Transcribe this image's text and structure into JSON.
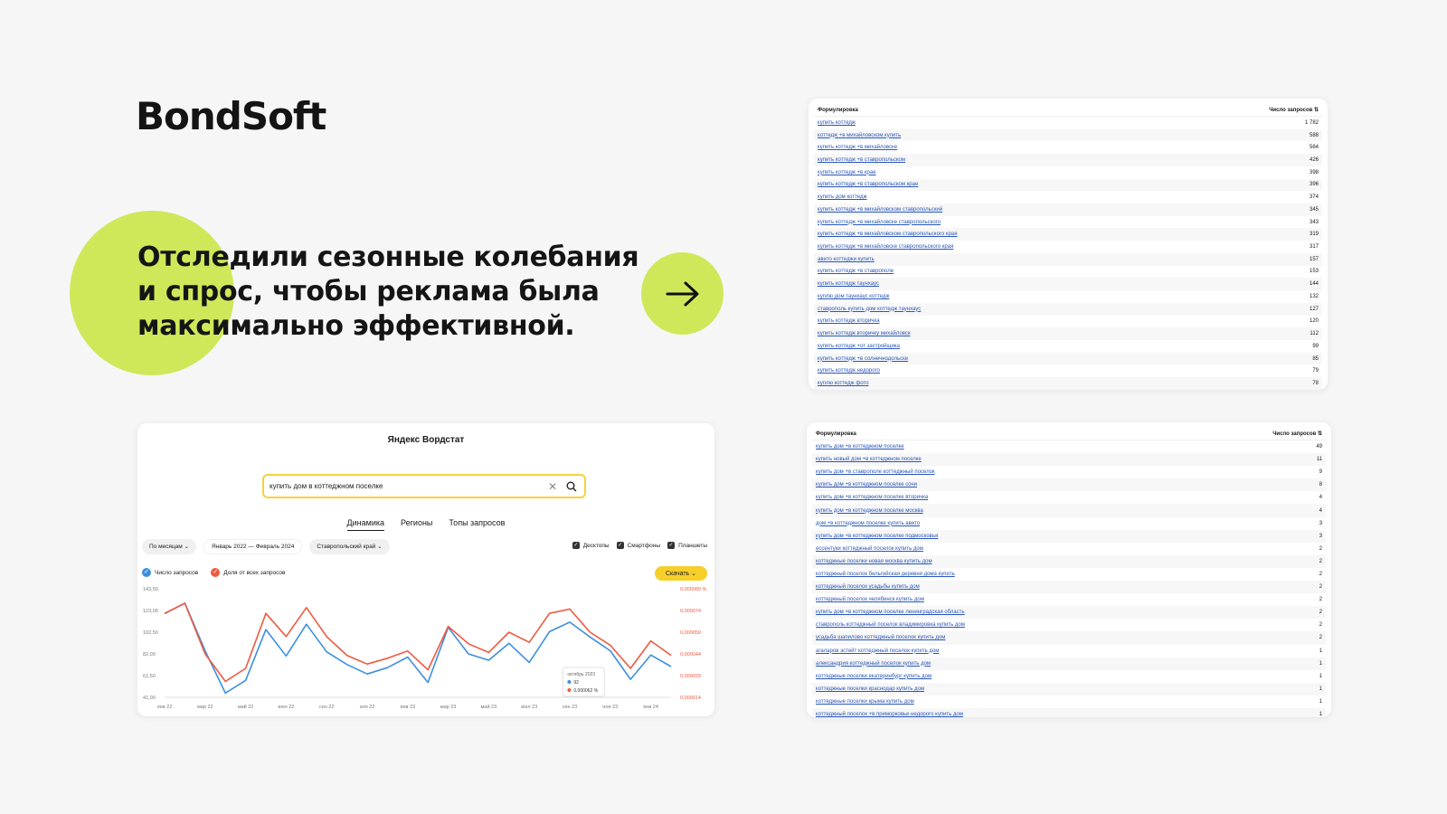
{
  "brand": {
    "logo_text": "BondSoft",
    "accent_color": "#cfe85a"
  },
  "headline": {
    "text": "Отследили сезонные колебания и спрос, чтобы реклама была максимально эффективной."
  },
  "arrow_button": {
    "icon": "arrow-right-icon"
  },
  "wordstat": {
    "title": "Яндекс Вордстат",
    "search_value": "купить дом в коттеджном поселке",
    "tabs": [
      "Динамика",
      "Регионы",
      "Топы запросов"
    ],
    "active_tab": "Динамика",
    "filters": {
      "period_group": "По месяцам",
      "date_range": "Январь 2022 — Февраль 2024",
      "region": "Ставропольский край"
    },
    "devices": [
      "Десктопы",
      "Смартфоны",
      "Планшеты"
    ],
    "legend": {
      "count": "Число запросов",
      "share": "Доля от всех запросов"
    },
    "download_label": "Скачать",
    "tooltip": {
      "title": "октябрь 2023",
      "count": "92",
      "share": "0,000062 %"
    }
  },
  "chart_data": {
    "type": "line",
    "x": [
      "янв 22",
      "фев 22",
      "мар 22",
      "апр 22",
      "май 22",
      "июн 22",
      "июл 22",
      "авг 22",
      "сен 22",
      "окт 22",
      "ноя 22",
      "дек 22",
      "янв 23",
      "фев 23",
      "мар 23",
      "апр 23",
      "май 23",
      "июн 23",
      "июл 23",
      "авг 23",
      "сен 23",
      "окт 23",
      "ноя 23",
      "дек 23",
      "янв 24",
      "фев 24"
    ],
    "x_tick_labels": [
      "янв 22",
      "мар 22",
      "май 22",
      "июл 22",
      "сен 22",
      "ноя 22",
      "янв 23",
      "мар 23",
      "май 23",
      "июл 23",
      "сен 23",
      "ноя 23",
      "янв 24"
    ],
    "y_left_ticks": [
      "143,50",
      "123,00",
      "102,50",
      "82,00",
      "61,50",
      "41,00"
    ],
    "y_right_ticks": [
      "0,000089 %",
      "0,000074",
      "0,000059",
      "0,000044",
      "0,000029",
      "0,000014"
    ],
    "ylim_left": [
      41,
      143.5
    ],
    "ylim_right": [
      1.4e-05,
      8.9e-05
    ],
    "series": [
      {
        "name": "Число запросов",
        "color": "#3d8fe0",
        "axis": "left",
        "values": [
          120,
          130,
          85,
          45,
          57,
          105,
          80,
          110,
          84,
          72,
          63,
          69,
          79,
          55,
          107,
          82,
          76,
          92,
          74,
          103,
          112,
          98,
          85,
          58,
          81,
          70
        ]
      },
      {
        "name": "Доля от всех запросов",
        "color": "#ef5a3e",
        "axis": "right",
        "values": [
          7.2e-05,
          7.9e-05,
          4.4e-05,
          2.5e-05,
          3.4e-05,
          7.2e-05,
          5.6e-05,
          7.6e-05,
          5.6e-05,
          4.3e-05,
          3.7e-05,
          4.1e-05,
          4.6e-05,
          3.3e-05,
          6.3e-05,
          5.1e-05,
          4.5e-05,
          5.9e-05,
          5.2e-05,
          7.2e-05,
          7.5e-05,
          5.9e-05,
          5e-05,
          3.4e-05,
          5.3e-05,
          4.3e-05
        ]
      }
    ]
  },
  "table1": {
    "col_phrase": "Формулировка",
    "col_count": "Число запросов ⇅",
    "rows": [
      {
        "phrase": "купить коттедж",
        "count": "1 782"
      },
      {
        "phrase": "коттедж +в михайловском купить",
        "count": "588"
      },
      {
        "phrase": "купить коттедж +в михайловске",
        "count": "564"
      },
      {
        "phrase": "купить коттедж +в ставропольском",
        "count": "426"
      },
      {
        "phrase": "купить коттедж +в крае",
        "count": "398"
      },
      {
        "phrase": "купить коттедж +в ставропольском крае",
        "count": "396"
      },
      {
        "phrase": "купить дом коттедж",
        "count": "374"
      },
      {
        "phrase": "купить коттедж +в михайловском ставропольский",
        "count": "345"
      },
      {
        "phrase": "купить коттедж +в михайловске ставропольского",
        "count": "343"
      },
      {
        "phrase": "купить коттедж +в михайловском ставропольского края",
        "count": "319"
      },
      {
        "phrase": "купить коттедж +в михайловске ставропольского края",
        "count": "317"
      },
      {
        "phrase": "авито коттеджи купить",
        "count": "157"
      },
      {
        "phrase": "купить коттедж +в ставрополе",
        "count": "153"
      },
      {
        "phrase": "купить коттедж таунхаус",
        "count": "144"
      },
      {
        "phrase": "куплю дом таунхаус коттедж",
        "count": "132"
      },
      {
        "phrase": "ставрополь купить дом коттедж таунхаус",
        "count": "127"
      },
      {
        "phrase": "купить коттедж вторичка",
        "count": "120"
      },
      {
        "phrase": "купить коттедж вторичку михайловск",
        "count": "112"
      },
      {
        "phrase": "купить коттедж +от застройщика",
        "count": "99"
      },
      {
        "phrase": "купить коттедж +в солнечнодольске",
        "count": "85"
      },
      {
        "phrase": "купить коттедж недорого",
        "count": "79"
      },
      {
        "phrase": "куплю коттедж фото",
        "count": "78"
      }
    ]
  },
  "table2": {
    "col_phrase": "Формулировка",
    "col_count": "Число запросов ⇅",
    "rows": [
      {
        "phrase": "купить дом +в коттеджном поселке",
        "count": "49"
      },
      {
        "phrase": "купить новый дом +в коттеджном поселке",
        "count": "11"
      },
      {
        "phrase": "купить дом +в ставрополе коттеджный поселок",
        "count": "9"
      },
      {
        "phrase": "купить дом +в коттеджном поселке сочи",
        "count": "8"
      },
      {
        "phrase": "купить дом +в коттеджном поселке вторичка",
        "count": "4"
      },
      {
        "phrase": "купить дом +в коттеджном поселке москва",
        "count": "4"
      },
      {
        "phrase": "дом +в коттеджном поселке купить авито",
        "count": "3"
      },
      {
        "phrase": "купить дом +в коттеджном поселке подмосковья",
        "count": "3"
      },
      {
        "phrase": "ессентуки коттеджный поселок купить дом",
        "count": "2"
      },
      {
        "phrase": "коттеджные поселки новая москва купить дом",
        "count": "2"
      },
      {
        "phrase": "коттеджный поселок бельгийская деревня дома купить",
        "count": "2"
      },
      {
        "phrase": "коттеджный поселок усадьбы купить дом",
        "count": "2"
      },
      {
        "phrase": "коттеджный поселок челябинск купить дом",
        "count": "2"
      },
      {
        "phrase": "купить дом +в коттеджном поселке ленинградская область",
        "count": "2"
      },
      {
        "phrase": "ставрополь коттеджный поселок владимировка купить дом",
        "count": "2"
      },
      {
        "phrase": "усадьба шапилово коттеджный поселок купить дом",
        "count": "2"
      },
      {
        "phrase": "агаларов эстейт коттеджный поселок купить дом",
        "count": "1"
      },
      {
        "phrase": "александрия коттеджный поселок купить дом",
        "count": "1"
      },
      {
        "phrase": "коттеджные поселки екатеринбург купить дом",
        "count": "1"
      },
      {
        "phrase": "коттеджные поселки краснодар купить дом",
        "count": "1"
      },
      {
        "phrase": "коттеджные поселки крыма купить дом",
        "count": "1"
      },
      {
        "phrase": "коттеджный поселок +в приморковье недорого купить дом",
        "count": "1"
      }
    ]
  }
}
